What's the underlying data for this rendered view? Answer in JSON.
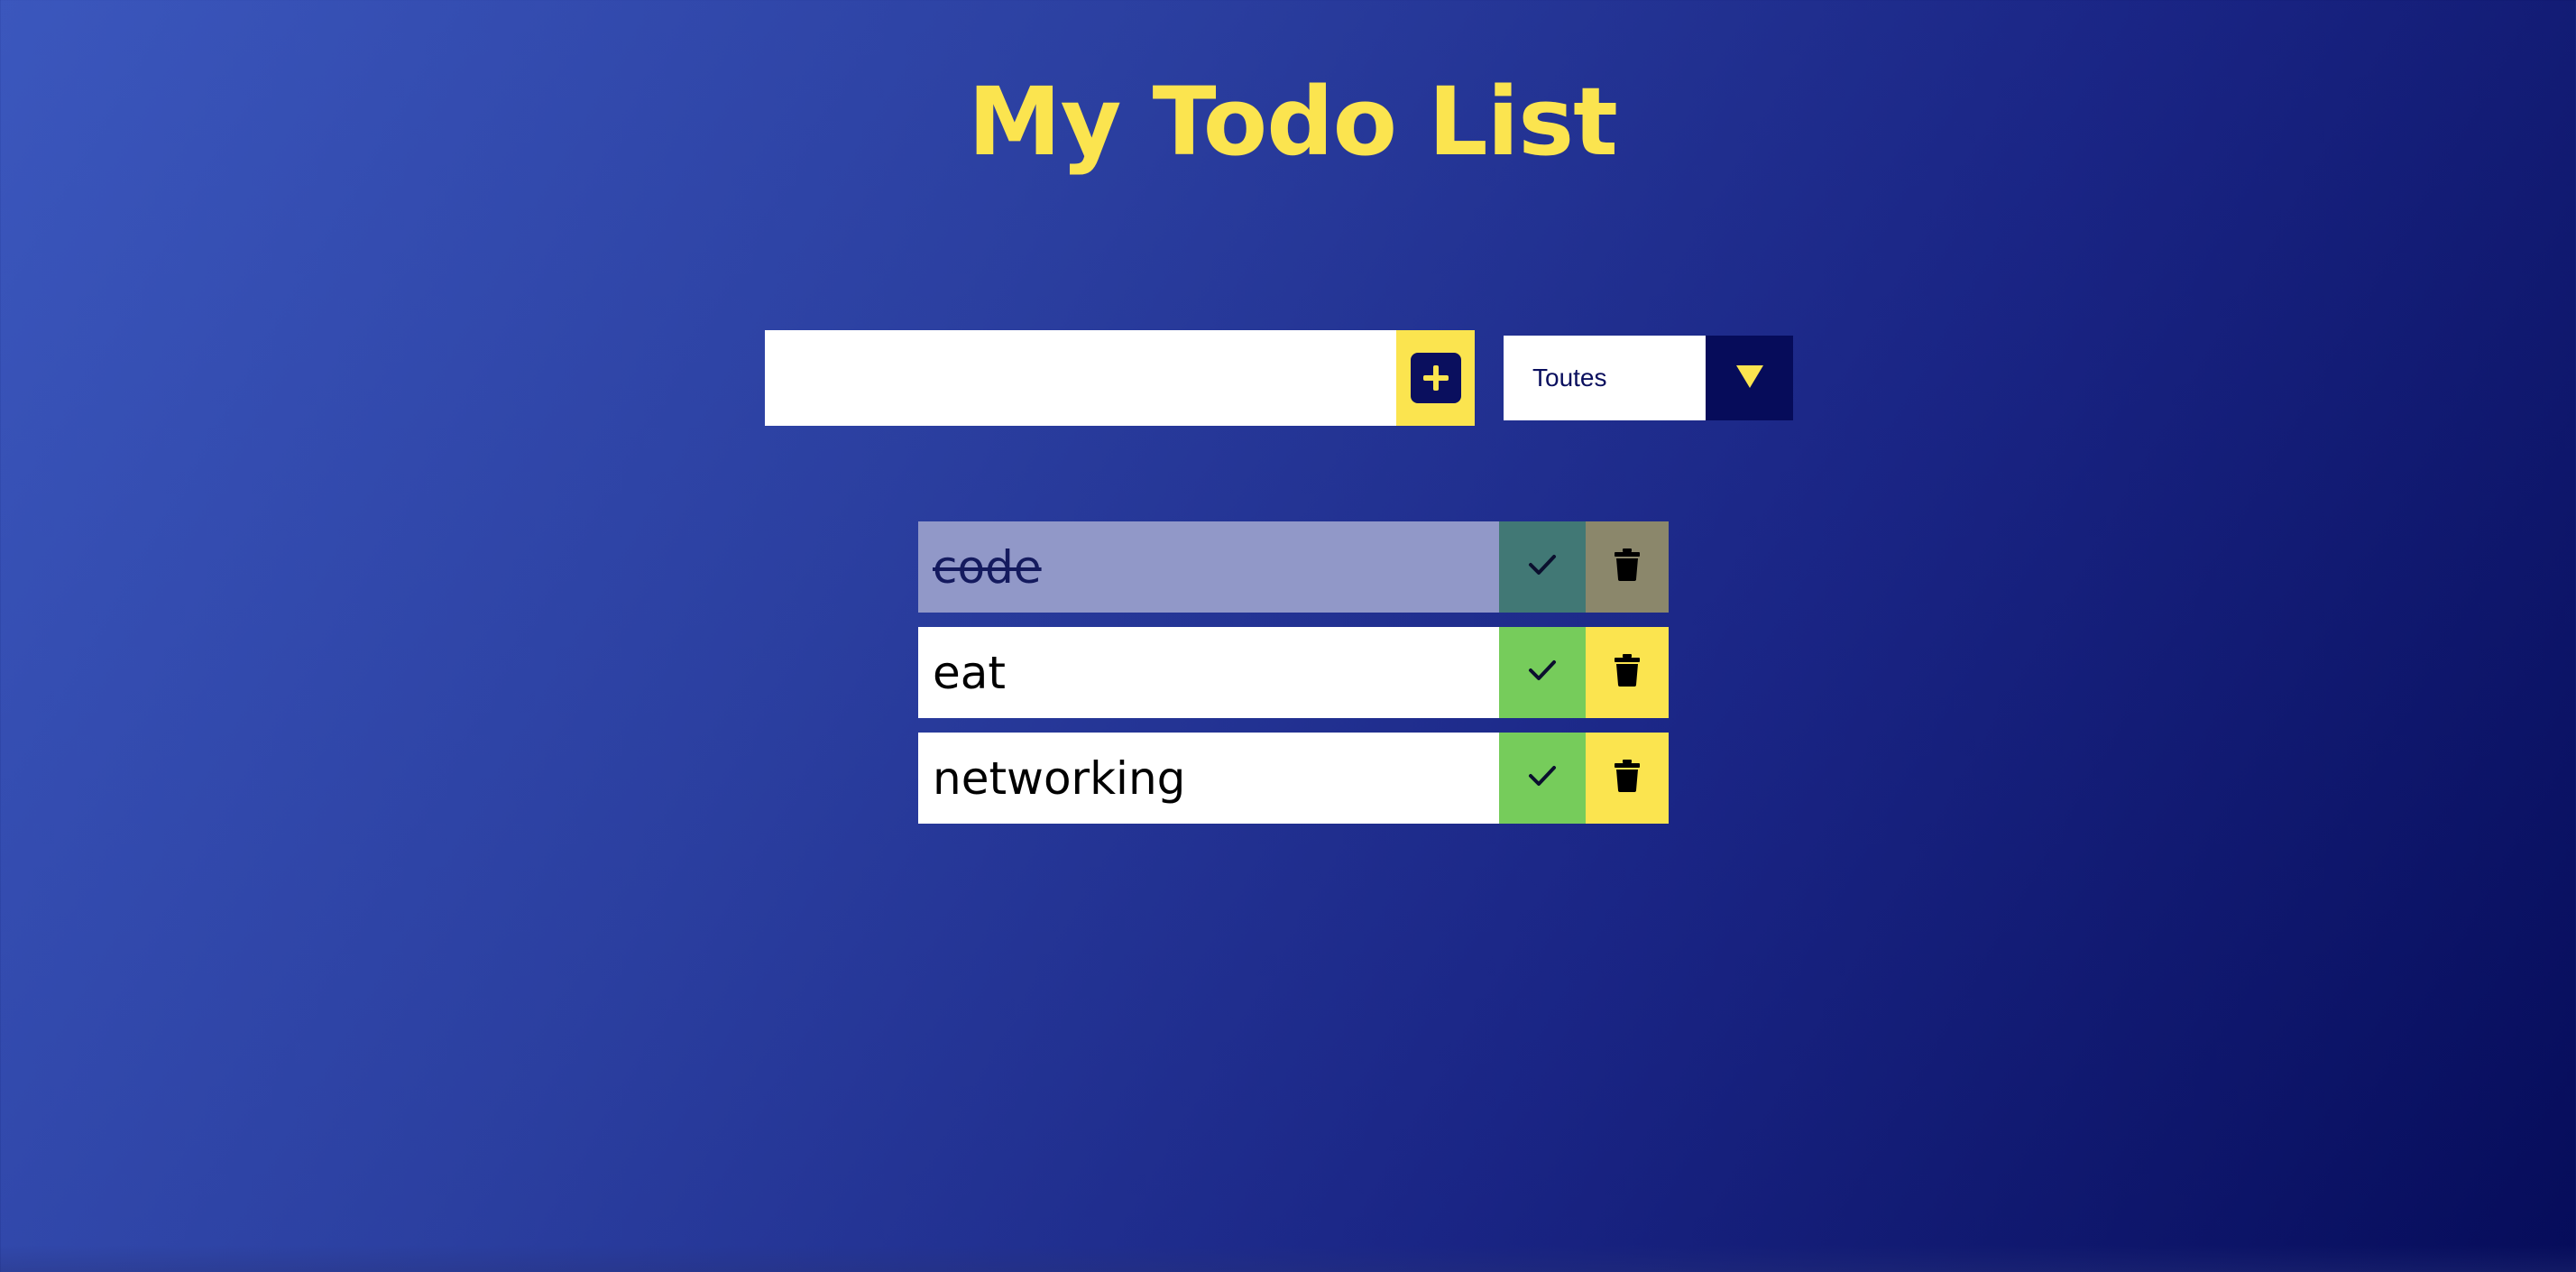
{
  "header": {
    "title": "My Todo List"
  },
  "form": {
    "input_value": "",
    "input_placeholder": "",
    "add_icon": "plus-icon"
  },
  "filter": {
    "selected": "Toutes",
    "arrow_icon": "triangle-down-icon"
  },
  "todos": [
    {
      "text": "code",
      "completed": true
    },
    {
      "text": "eat",
      "completed": false
    },
    {
      "text": "networking",
      "completed": false
    }
  ],
  "colors": {
    "accent_yellow": "#fbe44f",
    "dark_navy": "#060c5a",
    "check_green": "#76cc5b",
    "completed_text_bg": "#9198c8",
    "completed_check": "#417875",
    "completed_trash": "#8b876b"
  }
}
